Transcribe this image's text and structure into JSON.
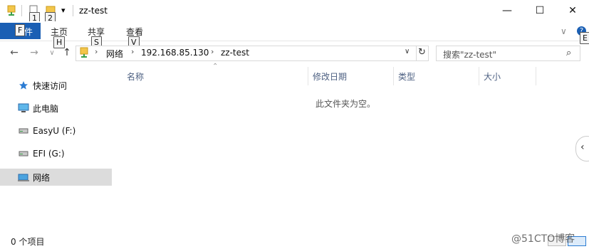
{
  "window": {
    "title": "zz-test",
    "controls": {
      "minimize": "—",
      "maximize": "☐",
      "close": "✕"
    }
  },
  "quick_access_toolbar": {
    "keytips": [
      "1",
      "2"
    ],
    "dropdown_glyph": "▾"
  },
  "ribbon": {
    "file_tab": {
      "label": "文件",
      "keytip": "F"
    },
    "tabs": [
      {
        "label": "主页",
        "keytip": "H"
      },
      {
        "label": "共享",
        "keytip": "S"
      },
      {
        "label": "查看",
        "keytip": "V"
      }
    ],
    "help_keytip": "E",
    "expand_glyph": "∨"
  },
  "address": {
    "crumbs": [
      "网络",
      "192.168.85.130",
      "zz-test"
    ],
    "search_placeholder": "搜索\"zz-test\""
  },
  "nav_pane": {
    "items": [
      {
        "label": "快速访问",
        "icon": "star-icon"
      },
      {
        "label": "此电脑",
        "icon": "computer-icon"
      },
      {
        "label": "EasyU (F:)",
        "icon": "drive-icon"
      },
      {
        "label": "EFI (G:)",
        "icon": "drive-icon"
      },
      {
        "label": "网络",
        "icon": "network-icon",
        "selected": true
      }
    ]
  },
  "content": {
    "columns": [
      "名称",
      "修改日期",
      "类型",
      "大小"
    ],
    "empty_message": "此文件夹为空。"
  },
  "status_bar": {
    "item_count": "0 个项目"
  },
  "watermark": "@51CTO博客",
  "colors": {
    "accent": "#1a5fb4",
    "selected_bg": "#dcdcdc",
    "column_header": "#4d6082"
  }
}
